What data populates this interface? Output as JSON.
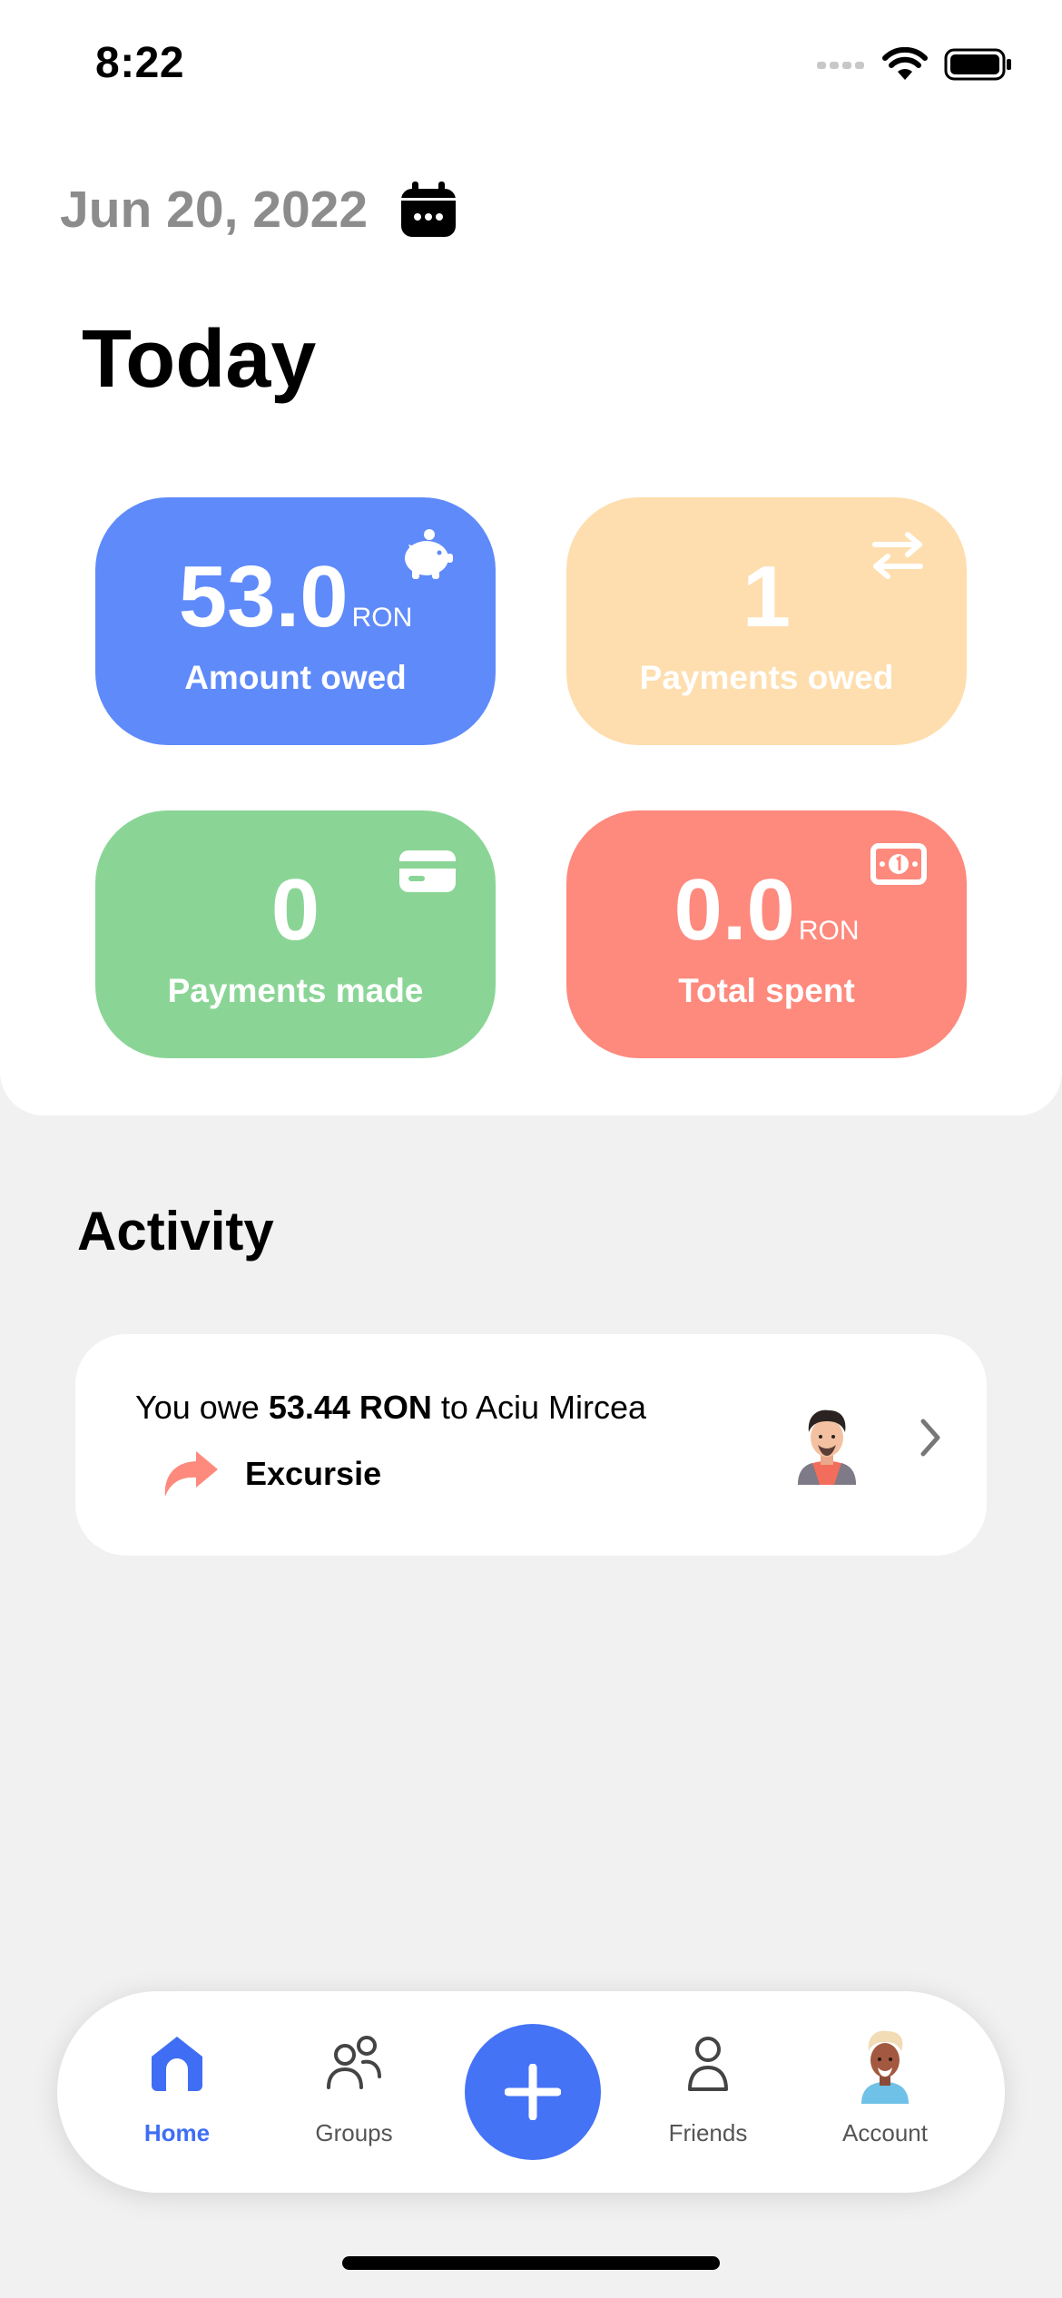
{
  "status_bar": {
    "time": "8:22"
  },
  "header": {
    "date": "Jun 20, 2022",
    "title": "Today"
  },
  "stats": {
    "amount_owed": {
      "value": "53.0",
      "unit": "RON",
      "label": "Amount owed",
      "icon": "piggy-bank-icon"
    },
    "payments_owed": {
      "value": "1",
      "label": "Payments owed",
      "icon": "transfer-arrows-icon"
    },
    "payments_made": {
      "value": "0",
      "label": "Payments made",
      "icon": "credit-card-icon"
    },
    "total_spent": {
      "value": "0.0",
      "unit": "RON",
      "label": "Total spent",
      "icon": "banknote-icon"
    }
  },
  "colors": {
    "blue": "#5f8afa",
    "peach": "#fedeae",
    "green": "#8ad596",
    "red": "#fe897d",
    "accent": "#4573f5"
  },
  "activity": {
    "title": "Activity",
    "items": [
      {
        "prefix": "You owe",
        "amount": "53.44 RON",
        "middle": "to",
        "person": "Aciu Mircea",
        "group": "Excursie"
      }
    ]
  },
  "tabbar": {
    "home": "Home",
    "groups": "Groups",
    "friends": "Friends",
    "account": "Account"
  }
}
